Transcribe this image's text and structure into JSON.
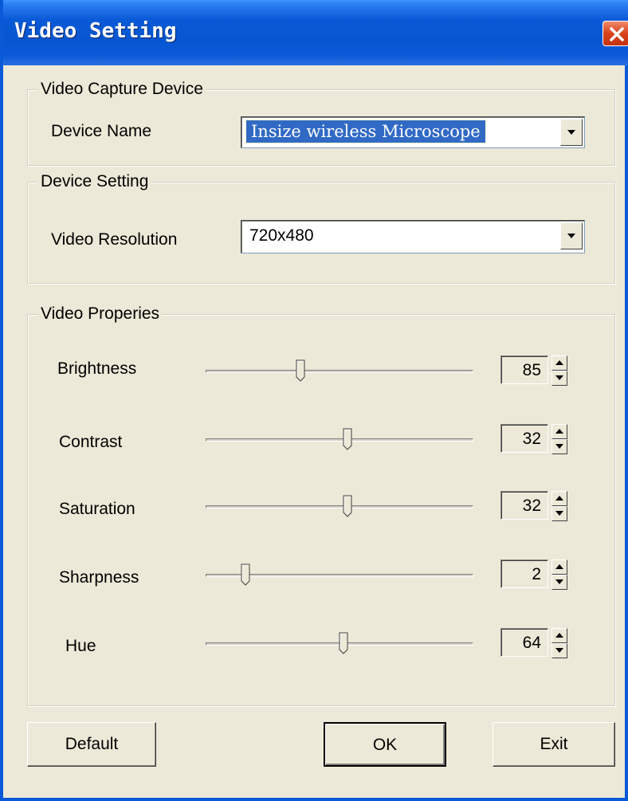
{
  "window": {
    "title": "Video Setting"
  },
  "capture_group": {
    "label": "Video Capture Device",
    "device_name_label": "Device Name",
    "device_name_value": "Insize wireless Microscope"
  },
  "device_group": {
    "label": "Device Setting",
    "resolution_label": "Video Resolution",
    "resolution_value": "720x480"
  },
  "properties_group": {
    "label": "Video Properies",
    "items": [
      {
        "label": "Brightness",
        "value": "85",
        "slider_fraction": 0.355
      },
      {
        "label": "Contrast",
        "value": "32",
        "slider_fraction": 0.53
      },
      {
        "label": "Saturation",
        "value": "32",
        "slider_fraction": 0.53
      },
      {
        "label": "Sharpness",
        "value": "2",
        "slider_fraction": 0.15
      },
      {
        "label": "Hue",
        "value": "64",
        "slider_fraction": 0.515
      }
    ]
  },
  "buttons": {
    "default": "Default",
    "ok": "OK",
    "exit": "Exit"
  },
  "icons": {
    "close": "close-icon",
    "dropdown": "chevron-down-icon",
    "spin_up": "arrow-up-icon",
    "spin_down": "arrow-down-icon"
  }
}
